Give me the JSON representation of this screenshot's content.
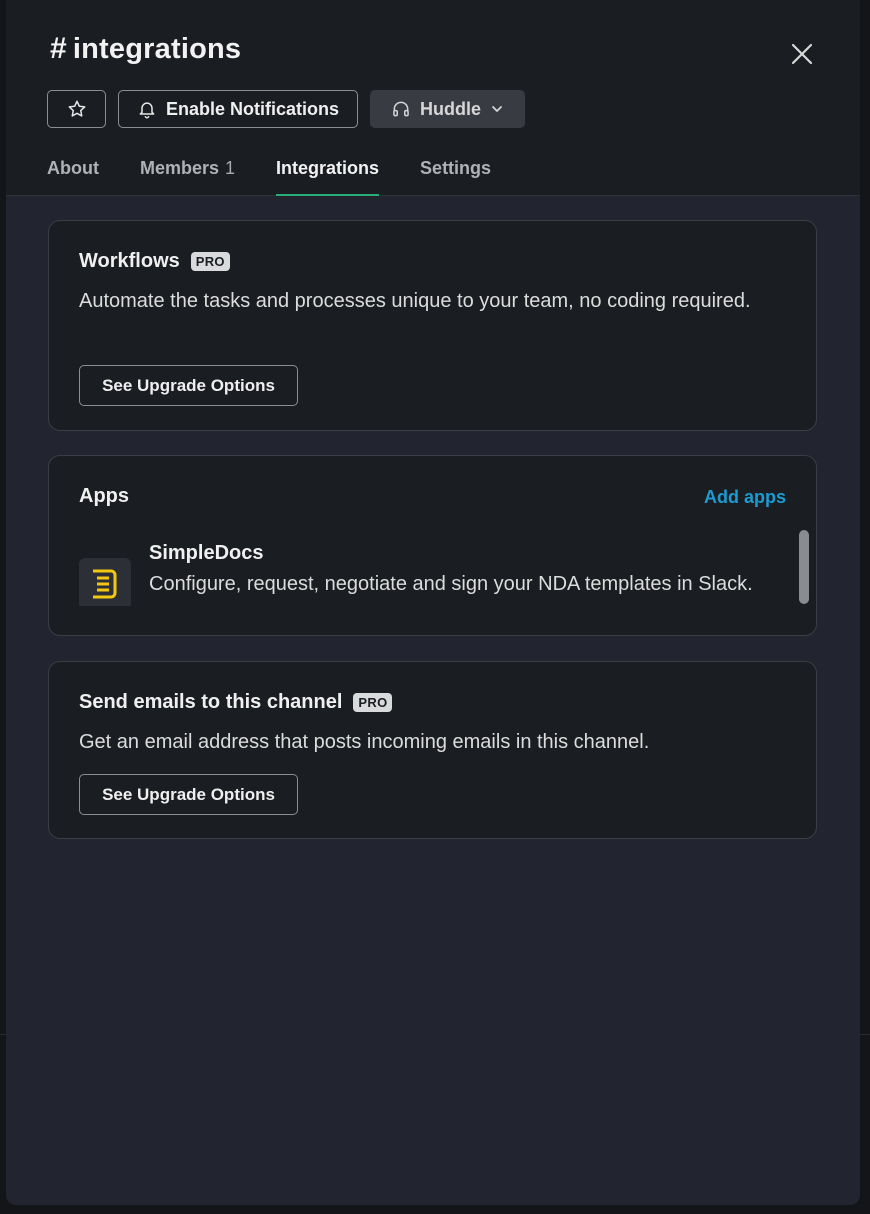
{
  "channel": {
    "hash": "#",
    "name": "integrations"
  },
  "header_buttons": {
    "star_icon": "star-outline",
    "enable_notifications_label": "Enable Notifications",
    "huddle_label": "Huddle"
  },
  "tabs": [
    {
      "label": "About"
    },
    {
      "label": "Members",
      "count": "1"
    },
    {
      "label": "Integrations",
      "active": true
    },
    {
      "label": "Settings"
    }
  ],
  "workflows": {
    "title": "Workflows",
    "badge": "PRO",
    "description": "Automate the tasks and processes unique to your team, no coding required.",
    "button_label": "See Upgrade Options"
  },
  "apps": {
    "title": "Apps",
    "add_label": "Add apps",
    "items": [
      {
        "name": "SimpleDocs",
        "description": "Configure, request, negotiate and sign your NDA templates in Slack.",
        "icon": "simpledocs-icon"
      }
    ]
  },
  "emails": {
    "title": "Send emails to this channel",
    "badge": "PRO",
    "description": "Get an email address that posts incoming emails in this channel.",
    "button_label": "See Upgrade Options"
  },
  "colors": {
    "accent_tab": "#2bac76",
    "link": "#1d9bd1",
    "app_icon": "#f2c811"
  }
}
